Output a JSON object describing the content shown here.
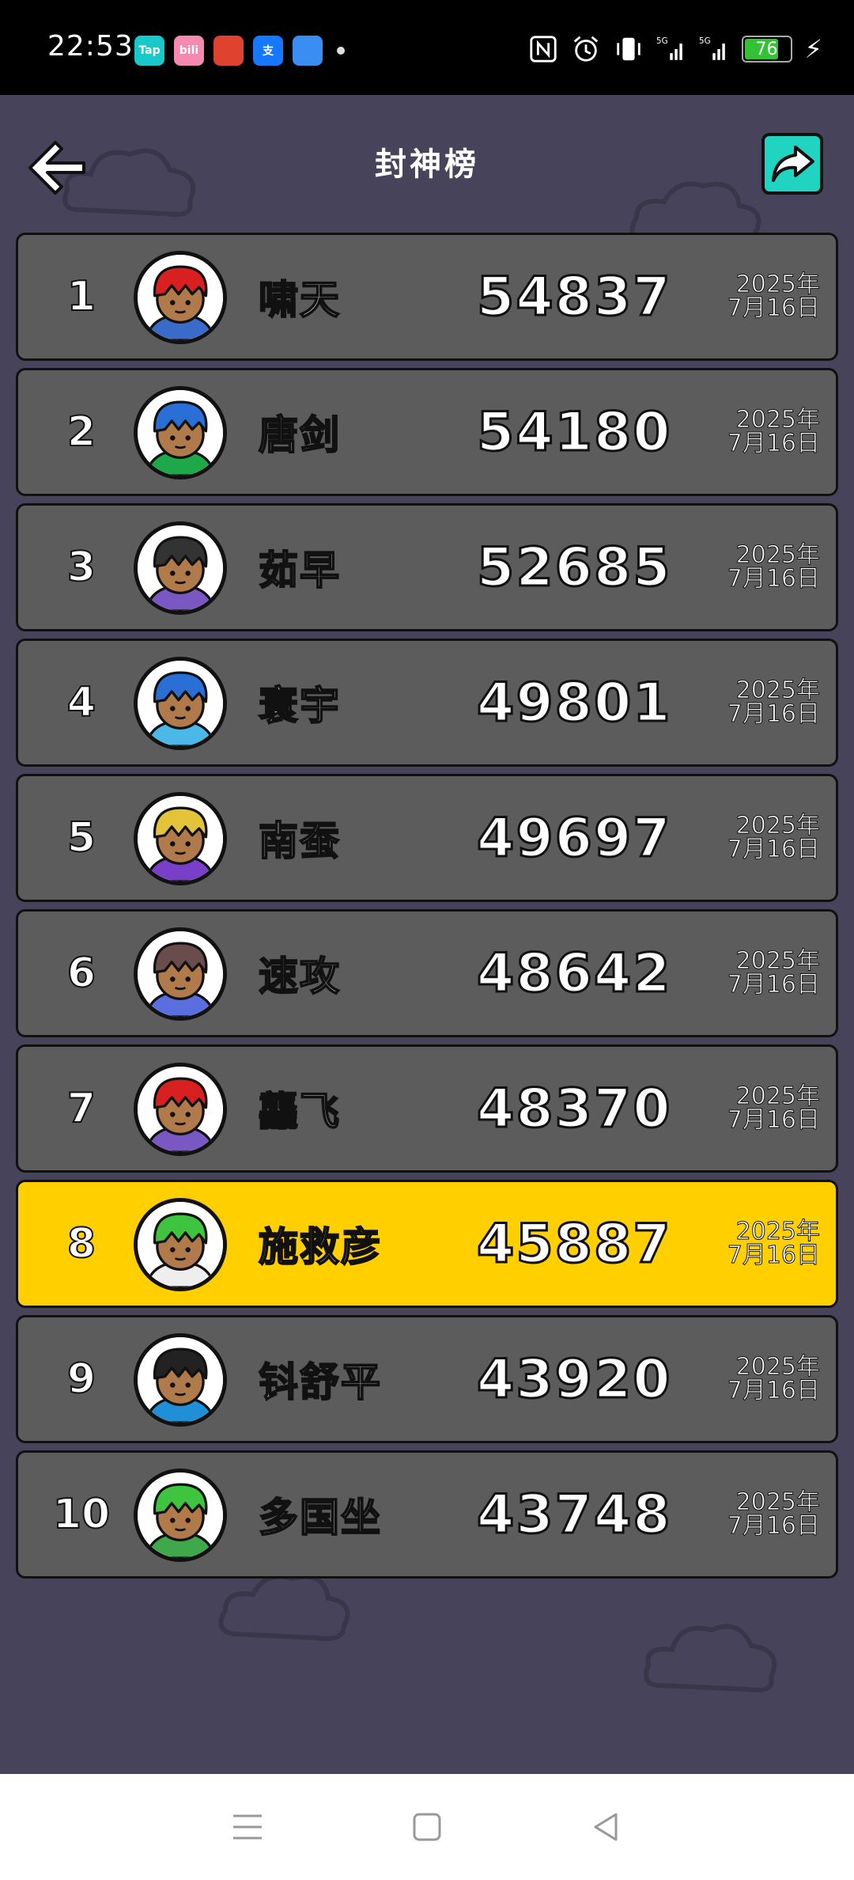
{
  "status_bar": {
    "time": "22:53",
    "battery": "76",
    "apps": [
      {
        "name": "taptap-icon",
        "label": "Tap",
        "color": "#19c8c8"
      },
      {
        "name": "bilibili-icon",
        "label": "bili",
        "color": "#f58ab0"
      },
      {
        "name": "red-app-icon",
        "label": "",
        "color": "#e04230"
      },
      {
        "name": "alipay-icon",
        "label": "支",
        "color": "#1677ff"
      },
      {
        "name": "weather-icon",
        "label": "",
        "color": "#3a8ef2"
      }
    ]
  },
  "header": {
    "title": "封神榜"
  },
  "leaderboard": [
    {
      "rank": "1",
      "name": "啸天",
      "score": "54837",
      "date": "2025年\n7月16日",
      "hair": "#d92020",
      "shirt": "#3a6bc8",
      "highlight": false
    },
    {
      "rank": "2",
      "name": "唐剑",
      "score": "54180",
      "date": "2025年\n7月16日",
      "hair": "#2a6fd6",
      "shirt": "#1fa84a",
      "highlight": false
    },
    {
      "rank": "3",
      "name": "茹早",
      "score": "52685",
      "date": "2025年\n7月16日",
      "hair": "#333333",
      "shirt": "#7a58c4",
      "highlight": false
    },
    {
      "rank": "4",
      "name": "寰宇",
      "score": "49801",
      "date": "2025年\n7月16日",
      "hair": "#2a6fd6",
      "shirt": "#4cb8e8",
      "highlight": false
    },
    {
      "rank": "5",
      "name": "南蚕",
      "score": "49697",
      "date": "2025年\n7月16日",
      "hair": "#e3c33a",
      "shirt": "#7a3fc8",
      "highlight": false
    },
    {
      "rank": "6",
      "name": "速攻",
      "score": "48642",
      "date": "2025年\n7月16日",
      "hair": "#6b4c4c",
      "shirt": "#5b6ee0",
      "highlight": false
    },
    {
      "rank": "7",
      "name": "龘飞",
      "score": "48370",
      "date": "2025年\n7月16日",
      "hair": "#d92020",
      "shirt": "#7a58c4",
      "highlight": false
    },
    {
      "rank": "8",
      "name": "施救彦",
      "score": "45887",
      "date": "2025年\n7月16日",
      "hair": "#3fc43f",
      "shirt": "#eeeeee",
      "highlight": true
    },
    {
      "rank": "9",
      "name": "钭舒平",
      "score": "43920",
      "date": "2025年\n7月16日",
      "hair": "#222222",
      "shirt": "#1f8fd8",
      "highlight": false
    },
    {
      "rank": "10",
      "name": "多国坐",
      "score": "43748",
      "date": "2025年\n7月16日",
      "hair": "#3fc43f",
      "shirt": "#3fa84a",
      "highlight": false
    }
  ],
  "colors": {
    "background": "#46435a",
    "row": "#5c5c5c",
    "highlight_row": "#ffcf00",
    "share_button": "#21d4c2"
  }
}
